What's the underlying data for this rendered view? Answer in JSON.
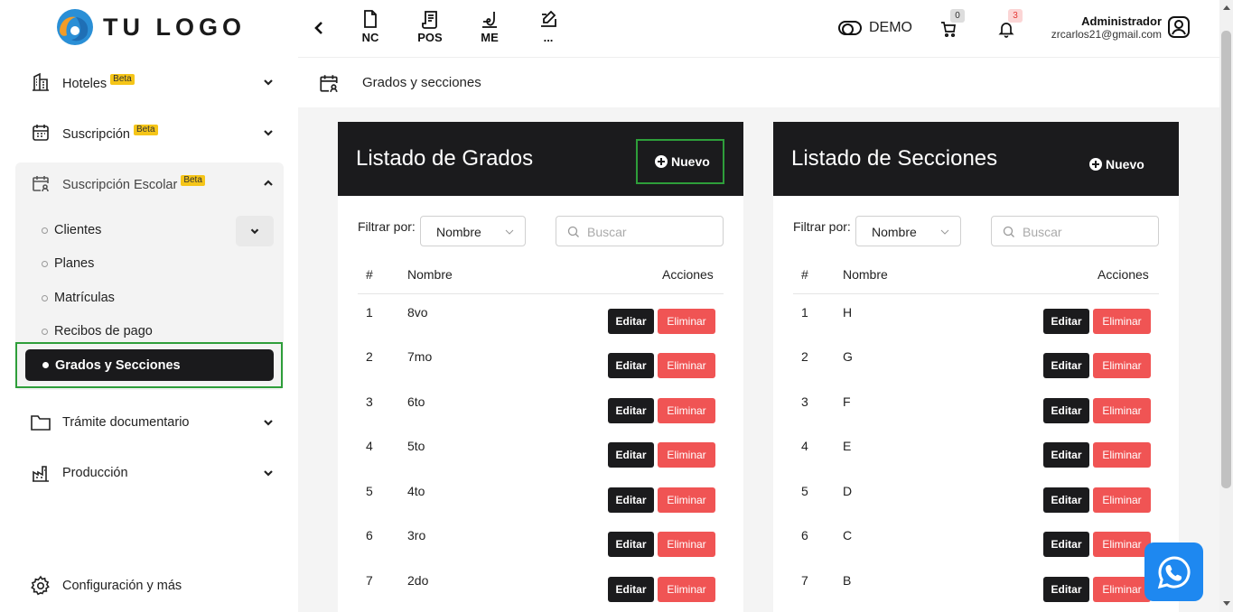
{
  "logo": {
    "text": "TU LOGO"
  },
  "sidebar": {
    "items": [
      {
        "label": "Hoteles",
        "badge": "Beta",
        "icon": "building-icon"
      },
      {
        "label": "Suscripción",
        "badge": "Beta",
        "icon": "calendar-icon"
      },
      {
        "label": "Suscripción Escolar",
        "badge": "Beta",
        "icon": "calendar-user-icon"
      },
      {
        "label": "Trámite documentario",
        "icon": "folder-icon"
      },
      {
        "label": "Producción",
        "icon": "factory-icon"
      }
    ],
    "subitems": [
      "Clientes",
      "Planes",
      "Matrículas",
      "Recibos de pago"
    ],
    "active": "Grados y Secciones",
    "settings": "Configuración y más"
  },
  "topbar": {
    "buttons": [
      {
        "label": "NC",
        "icon": "document-icon"
      },
      {
        "label": "POS",
        "icon": "receipt-icon"
      },
      {
        "label": "ME",
        "icon": "signature-icon"
      },
      {
        "label": "...",
        "icon": "edit-icon"
      }
    ],
    "demo": "DEMO",
    "cart_count": "0",
    "notif_count": "3",
    "user_name": "Administrador",
    "user_email": "zrcarlos21@gmail.com"
  },
  "breadcrumb": "Grados y secciones",
  "grados": {
    "title": "Listado de Grados",
    "new_label": "Nuevo",
    "filter_label": "Filtrar por:",
    "filter_value": "Nombre",
    "search_placeholder": "Buscar",
    "columns": [
      "#",
      "Nombre",
      "Acciones"
    ],
    "rows": [
      {
        "num": "1",
        "name": "8vo"
      },
      {
        "num": "2",
        "name": "7mo"
      },
      {
        "num": "3",
        "name": "6to"
      },
      {
        "num": "4",
        "name": "5to"
      },
      {
        "num": "5",
        "name": "4to"
      },
      {
        "num": "6",
        "name": "3ro"
      },
      {
        "num": "7",
        "name": "2do"
      }
    ],
    "edit_label": "Editar",
    "delete_label": "Eliminar"
  },
  "secciones": {
    "title": "Listado de Secciones",
    "new_label": "Nuevo",
    "filter_label": "Filtrar por:",
    "filter_value": "Nombre",
    "search_placeholder": "Buscar",
    "columns": [
      "#",
      "Nombre",
      "Acciones"
    ],
    "rows": [
      {
        "num": "1",
        "name": "H"
      },
      {
        "num": "2",
        "name": "G"
      },
      {
        "num": "3",
        "name": "F"
      },
      {
        "num": "4",
        "name": "E"
      },
      {
        "num": "5",
        "name": "D"
      },
      {
        "num": "6",
        "name": "C"
      },
      {
        "num": "7",
        "name": "B"
      }
    ],
    "edit_label": "Editar",
    "delete_label": "Eliminar"
  }
}
